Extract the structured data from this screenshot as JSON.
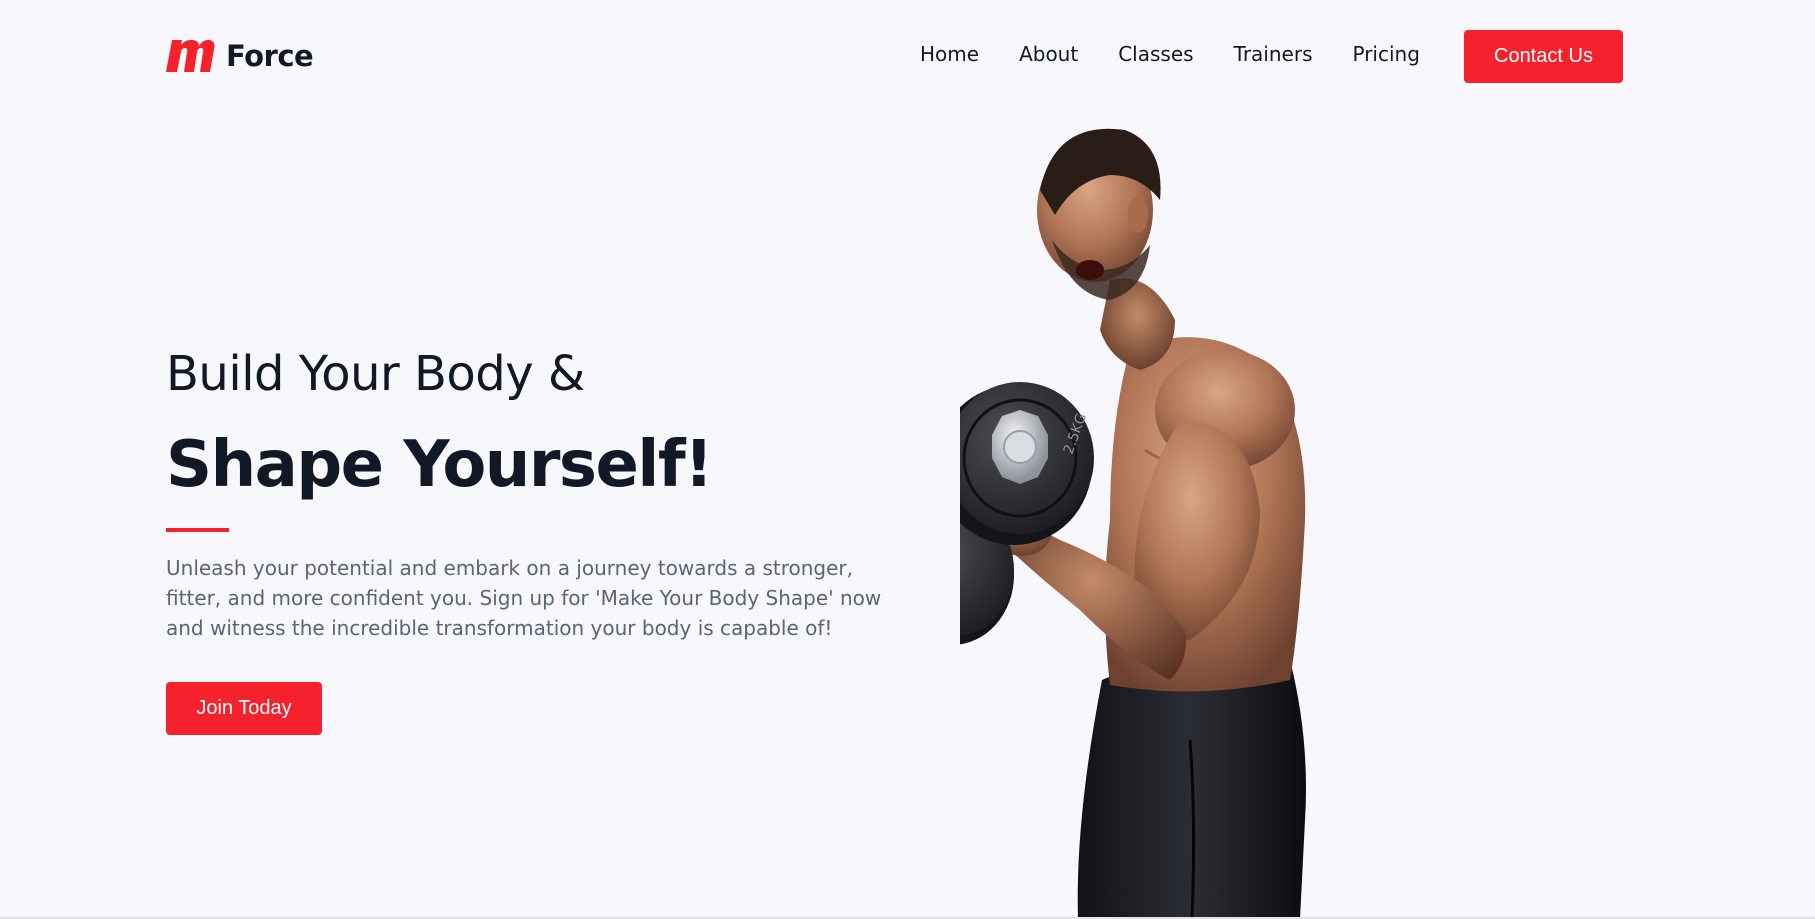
{
  "brand": {
    "name": "Force",
    "logo_icon": "m-logo-icon",
    "accent_color": "#f5222d"
  },
  "nav": {
    "items": [
      {
        "label": "Home"
      },
      {
        "label": "About"
      },
      {
        "label": "Classes"
      },
      {
        "label": "Trainers"
      },
      {
        "label": "Pricing"
      }
    ],
    "cta_label": "Contact Us"
  },
  "hero": {
    "kicker": "Build Your Body &",
    "title": "Shape Yourself!",
    "description": "Unleash your potential and embark on a journey towards a stronger, fitter, and more confident you. Sign up for 'Make Your Body Shape' now and witness the incredible transformation your body is capable of!",
    "cta_label": "Join Today",
    "image": {
      "subject": "muscular man curling a dumbbell",
      "dumbbell_plate_label": "2.5KG"
    }
  },
  "colors": {
    "background": "#f8f8fc",
    "text_dark": "#121826",
    "text_muted": "#5b6477",
    "button": "#f5222d",
    "button_text": "#ffffff"
  }
}
